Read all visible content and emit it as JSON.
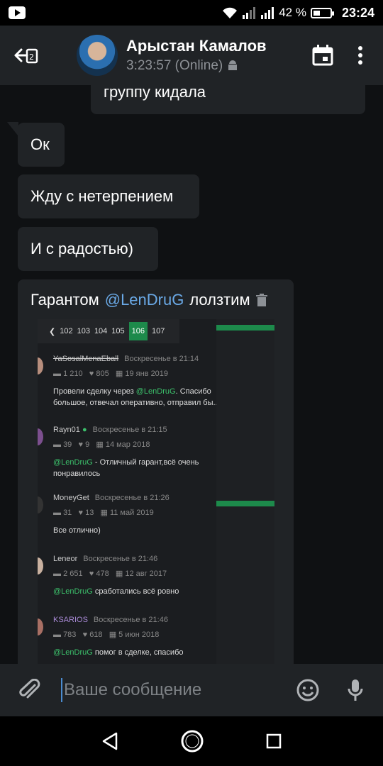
{
  "status_bar": {
    "battery": "42 %",
    "battery_level": 0.42,
    "time": "23:24"
  },
  "header": {
    "name": "Арыстан Камалов",
    "status": "3:23:57 (Online)"
  },
  "messages": [
    {
      "text": "группу кидала"
    },
    {
      "text": "Ок"
    },
    {
      "text": "Жду с нетерпением"
    },
    {
      "text": "И с радостью)"
    }
  ],
  "media_message": {
    "caption_before": "Гарантом ",
    "mention": "@LenDruG",
    "caption_after": " лолзтим",
    "screenshot": {
      "pager": [
        "102",
        "103",
        "104",
        "105",
        "106",
        "107"
      ],
      "pager_current": "106",
      "posts": [
        {
          "name": "YaSosalMenaEball",
          "date": "Воскресенье в 21:14",
          "msgs": "1 210",
          "likes": "805",
          "reg": "19 янв 2019",
          "text_pre": "Провели сделку через ",
          "text_mention": "@LenDruG",
          "text_post": ". Спасибо большое, отвечал оперативно, отправил бы..."
        },
        {
          "name": "Rayn01",
          "date": "Воскресенье в 21:15",
          "msgs": "39",
          "likes": "9",
          "reg": "14 мар 2018",
          "text_pre": "",
          "text_mention": "@LenDruG",
          "text_post": " - Отличный гарант,всё очень понравилось"
        },
        {
          "name": "MoneyGet",
          "date": "Воскресенье в 21:26",
          "msgs": "31",
          "likes": "13",
          "reg": "11 май 2019",
          "text_pre": "Все отлично)",
          "text_mention": "",
          "text_post": ""
        },
        {
          "name": "Leneor",
          "date": "Воскресенье в 21:46",
          "msgs": "2 651",
          "likes": "478",
          "reg": "12 авг 2017",
          "text_pre": "",
          "text_mention": "@LenDruG",
          "text_post": " сработались всё ровно"
        },
        {
          "name": "KSARIOS",
          "date": "Воскресенье в 21:46",
          "msgs": "783",
          "likes": "618",
          "reg": "5 июн 2018",
          "text_pre": "",
          "text_mention": "@LenDruG",
          "text_post": " помог в сделке, спасибо"
        }
      ]
    }
  },
  "input": {
    "placeholder": "Ваше сообщение"
  }
}
